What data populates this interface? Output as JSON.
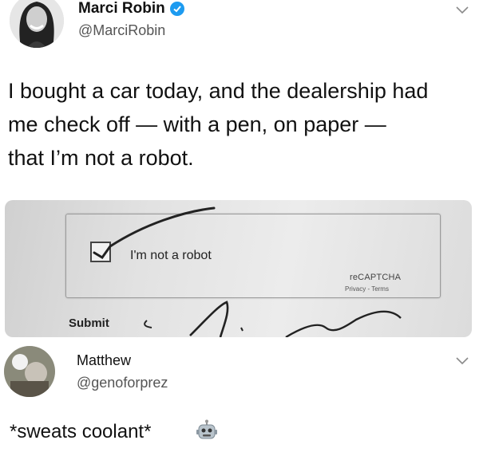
{
  "tweet": {
    "author_name": "Marci Robin",
    "author_handle": "@MarciRobin",
    "text_line1": "I bought a car today, and the dealership had",
    "text_line2": "me check off — with a pen, on paper —",
    "text_line3": "that I’m not a robot.",
    "photo": {
      "captcha_label": "I'm not a robot",
      "recaptcha_brand": "reCAPTCHA",
      "recaptcha_links": "Privacy - Terms",
      "submit_label": "Submit"
    }
  },
  "reply": {
    "author_name": "Matthew",
    "author_handle": "@genoforprez",
    "text": "*sweats coolant*",
    "emoji_icon": "robot-face-icon"
  },
  "colors": {
    "verified": "#1d9bf0",
    "handle": "#555555",
    "text": "#111111"
  }
}
